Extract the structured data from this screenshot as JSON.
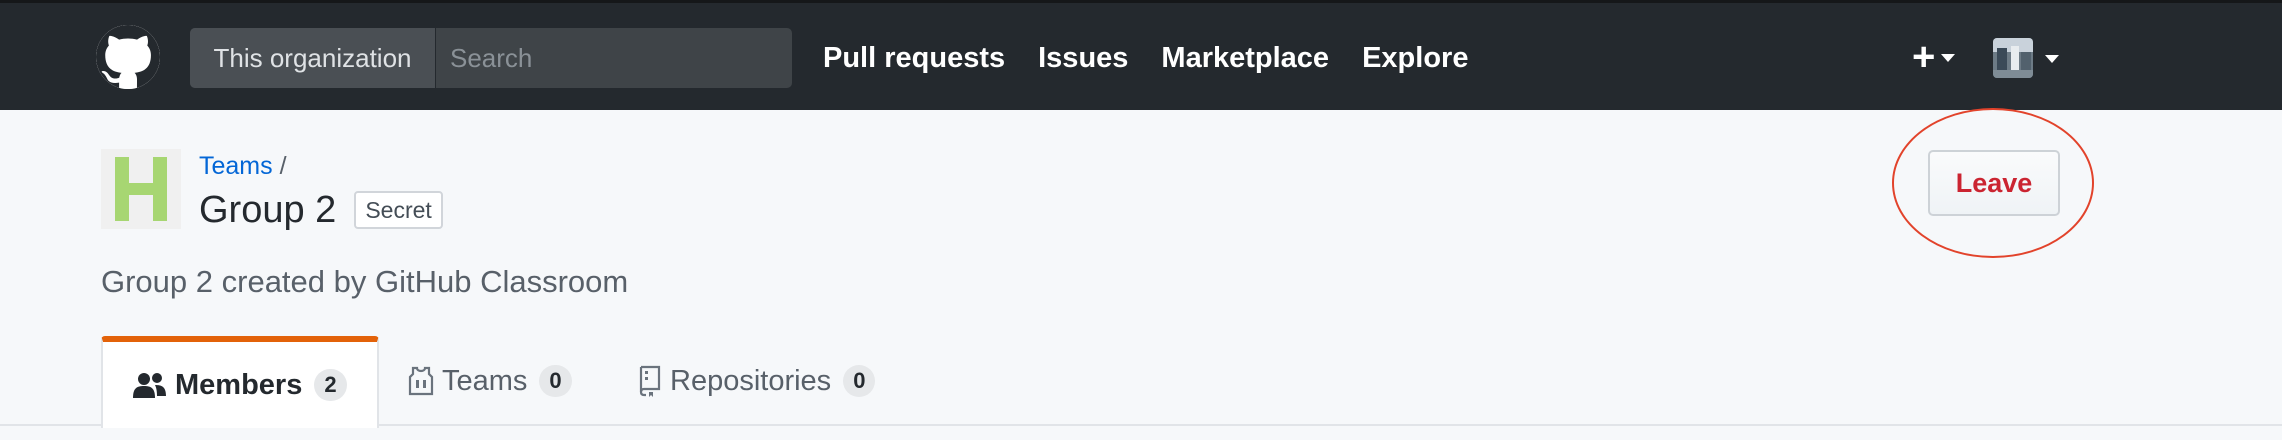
{
  "header": {
    "search_scope": "This organization",
    "search_placeholder": "Search",
    "nav": [
      "Pull requests",
      "Issues",
      "Marketplace",
      "Explore"
    ],
    "new_menu_icon": "plus-icon",
    "user_menu_icon": "avatar"
  },
  "team": {
    "breadcrumb_link": "Teams",
    "breadcrumb_separator": "/",
    "name": "Group 2",
    "visibility_badge": "Secret",
    "description": "Group 2 created by GitHub Classroom",
    "avatar_icon": "team-identicon",
    "avatar_color": "#a7d672"
  },
  "actions": {
    "leave_label": "Leave",
    "leave_color": "#cb2431",
    "annotation_color": "#e2432b"
  },
  "tabs": [
    {
      "label": "Members",
      "count": "2",
      "icon": "people-icon",
      "selected": true
    },
    {
      "label": "Teams",
      "count": "0",
      "icon": "jersey-icon",
      "selected": false
    },
    {
      "label": "Repositories",
      "count": "0",
      "icon": "repo-icon",
      "selected": false
    }
  ],
  "colors": {
    "header_bg": "#24292e",
    "link": "#0366d6",
    "selected_tab_accent": "#e36209"
  }
}
